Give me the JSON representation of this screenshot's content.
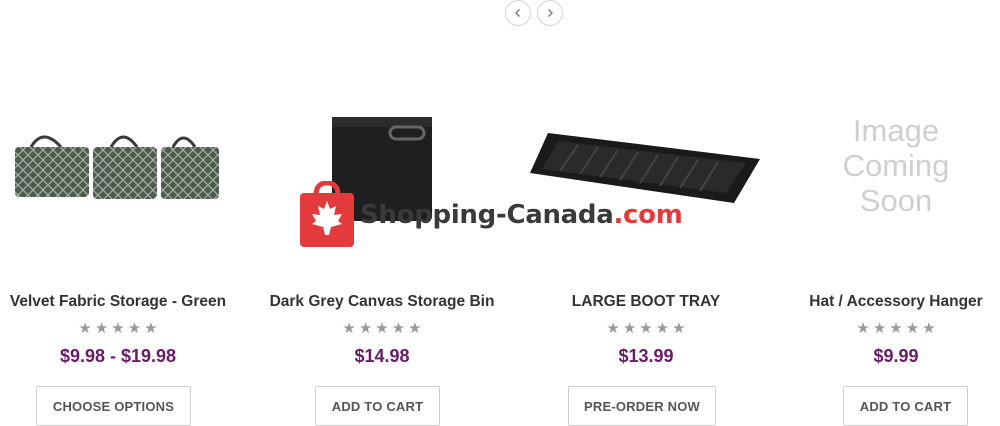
{
  "carousel": {
    "prev_icon": "chevron-left-icon",
    "next_icon": "chevron-right-icon"
  },
  "products": [
    {
      "title": "Velvet Fabric Storage - Green",
      "rating_stars": 0,
      "price": "$9.98 - $19.98",
      "button_label": "CHOOSE OPTIONS",
      "image": "green-fabric-baskets"
    },
    {
      "title": "Dark Grey Canvas Storage Bin",
      "rating_stars": 0,
      "price": "$14.98",
      "button_label": "ADD TO CART",
      "image": "dark-grey-canvas-bin"
    },
    {
      "title": "LARGE BOOT TRAY",
      "rating_stars": 0,
      "price": "$13.99",
      "button_label": "PRE-ORDER NOW",
      "image": "black-boot-tray"
    },
    {
      "title": "Hat / Accessory Hanger",
      "rating_stars": 0,
      "price": "$9.99",
      "button_label": "ADD TO CART",
      "image": "image-coming-soon",
      "placeholder_lines": [
        "Image",
        "Coming",
        "Soon"
      ]
    }
  ],
  "watermark": {
    "text_main": "Shopping-Canada",
    "text_accent": ".com",
    "icon": "maple-leaf-bag-icon"
  },
  "colors": {
    "price": "#6b1a6b",
    "watermark_red": "#e33b3b"
  }
}
